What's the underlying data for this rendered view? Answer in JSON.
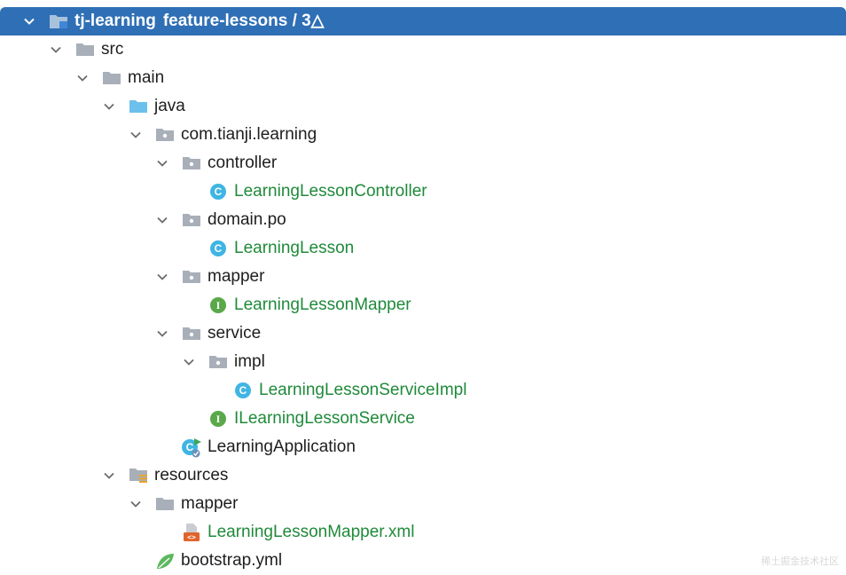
{
  "project": {
    "name": "tj-learning",
    "branch": "feature-lessons / 3△"
  },
  "tree": {
    "src": "src",
    "main": "main",
    "java": "java",
    "package": "com.tianji.learning",
    "controller": "controller",
    "controller_class": "LearningLessonController",
    "domain_po": "domain.po",
    "domain_class": "LearningLesson",
    "mapper": "mapper",
    "mapper_interface": "LearningLessonMapper",
    "service": "service",
    "impl": "impl",
    "service_impl_class": "LearningLessonServiceImpl",
    "service_interface": "ILearningLessonService",
    "app_class": "LearningApplication",
    "resources": "resources",
    "res_mapper": "mapper",
    "mapper_xml": "LearningLessonMapper.xml",
    "bootstrap": "bootstrap.yml"
  },
  "icons": {
    "folder": "folder-icon",
    "source_folder": "source-folder-icon",
    "package": "package-icon",
    "class": "class-icon",
    "interface": "interface-icon",
    "spring_app": "spring-app-icon",
    "resources_folder": "resources-folder-icon",
    "xml_file": "xml-file-icon",
    "yml_file": "yml-file-icon",
    "chevron": "chevron-down-icon"
  },
  "colors": {
    "selection": "#2f6fb5",
    "green_text": "#1f8a3a",
    "class_badge": "#3fb5e3",
    "interface_badge": "#5aa84a"
  },
  "watermark": "稀土掘金技术社区"
}
